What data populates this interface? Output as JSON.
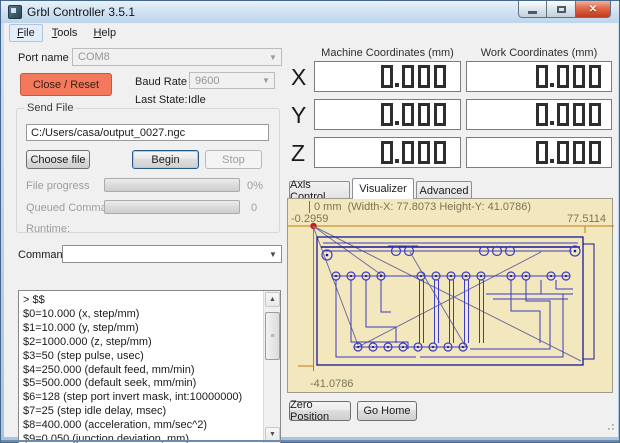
{
  "window": {
    "title": "Grbl Controller 3.5.1"
  },
  "menu": {
    "items": [
      "File",
      "Tools",
      "Help"
    ]
  },
  "connection": {
    "port_label": "Port name",
    "port_value": "COM8",
    "close_reset": "Close / Reset",
    "baud_label": "Baud Rate",
    "baud_value": "9600",
    "last_state_label": "Last State:",
    "last_state_value": "Idle"
  },
  "send_file": {
    "group_label": "Send File",
    "file_path": "C:/Users/casa/output_0027.ngc",
    "choose_file": "Choose file",
    "begin": "Begin",
    "stop": "Stop",
    "file_progress_label": "File progress",
    "file_progress_value": "0%",
    "queued_label": "Queued Commands",
    "queued_value": "0",
    "runtime_label": "Runtime:"
  },
  "command": {
    "label": "Command",
    "value": ""
  },
  "console": {
    "lines": [
      "> $$",
      "$0=10.000 (x, step/mm)",
      "$1=10.000 (y, step/mm)",
      "$2=1000.000 (z, step/mm)",
      "$3=50 (step pulse, usec)",
      "$4=250.000 (default feed, mm/min)",
      "$5=500.000 (default seek, mm/min)",
      "$6=128 (step port invert mask, int:10000000)",
      "$7=25 (step idle delay, msec)",
      "$8=400.000 (acceleration, mm/sec^2)",
      "$9=0.050 (junction deviation, mm)"
    ]
  },
  "coordinates": {
    "machine_header": "Machine Coordinates  (mm)",
    "work_header": "Work Coordinates  (mm)",
    "rows": [
      {
        "axis": "X",
        "machine": "0.000",
        "work": "0.000"
      },
      {
        "axis": "Y",
        "machine": "0.000",
        "work": "0.000"
      },
      {
        "axis": "Z",
        "machine": "0.000",
        "work": "0.000"
      }
    ]
  },
  "tabs": {
    "items": [
      "Axis Control",
      "Visualizer",
      "Advanced"
    ],
    "active": "Visualizer"
  },
  "visualizer": {
    "scale_label": "0 mm",
    "dims_label": "(Width-X: 77.8073  Height-Y: 41.0786)",
    "x_min": "-0.2959",
    "x_max": "77.5114",
    "y_min": "-41.0786"
  },
  "footer": {
    "zero_position": "Zero Position",
    "go_home": "Go Home"
  },
  "colors": {
    "accent_button": "#f4795c",
    "visualizer_bg": "#f3e7bd",
    "ruler": "#c07c10",
    "trace_blue": "#3b3bc4",
    "trace_navy": "#17179c",
    "rapid_line": "#7070a0",
    "origin_dot": "#cf1b10"
  }
}
